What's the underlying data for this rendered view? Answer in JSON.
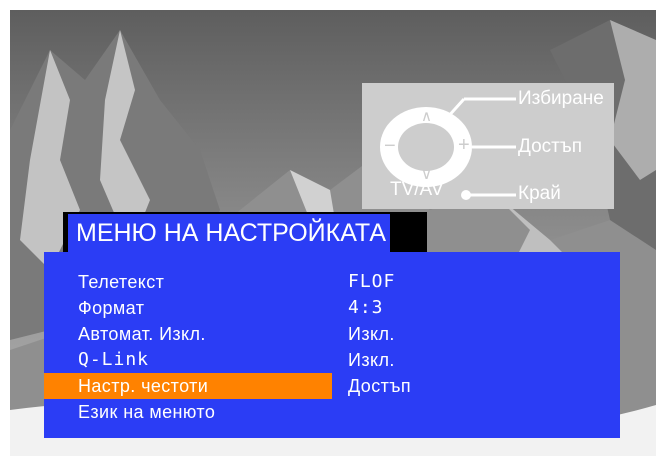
{
  "remote_hint": {
    "up_symbol": "∧",
    "down_symbol": "∨",
    "minus_symbol": "−",
    "plus_symbol": "+",
    "tvav_label": "TV/AV",
    "select_label": "Избиране",
    "access_label": "Достъп",
    "exit_label": "Край"
  },
  "menu": {
    "title": "МЕНЮ НА НАСТРОЙКАТА",
    "items": [
      {
        "label": "Телетекст",
        "value": "FLOF"
      },
      {
        "label": "Формат",
        "value": "4:3"
      },
      {
        "label": "Автомат. Изкл.",
        "value": "Изкл."
      },
      {
        "label": "Q-Link",
        "value": "Изкл."
      },
      {
        "label": "Настр. честоти",
        "value": "Достъп",
        "highlighted": true
      },
      {
        "label": "Език на менюто",
        "value": ""
      }
    ]
  },
  "colors": {
    "menu_background": "#2b3df5",
    "highlight": "#ff8200",
    "hint_panel": "#cdcdcd",
    "text": "#ffffff"
  },
  "icons": [
    "remote-dpad-icon"
  ]
}
